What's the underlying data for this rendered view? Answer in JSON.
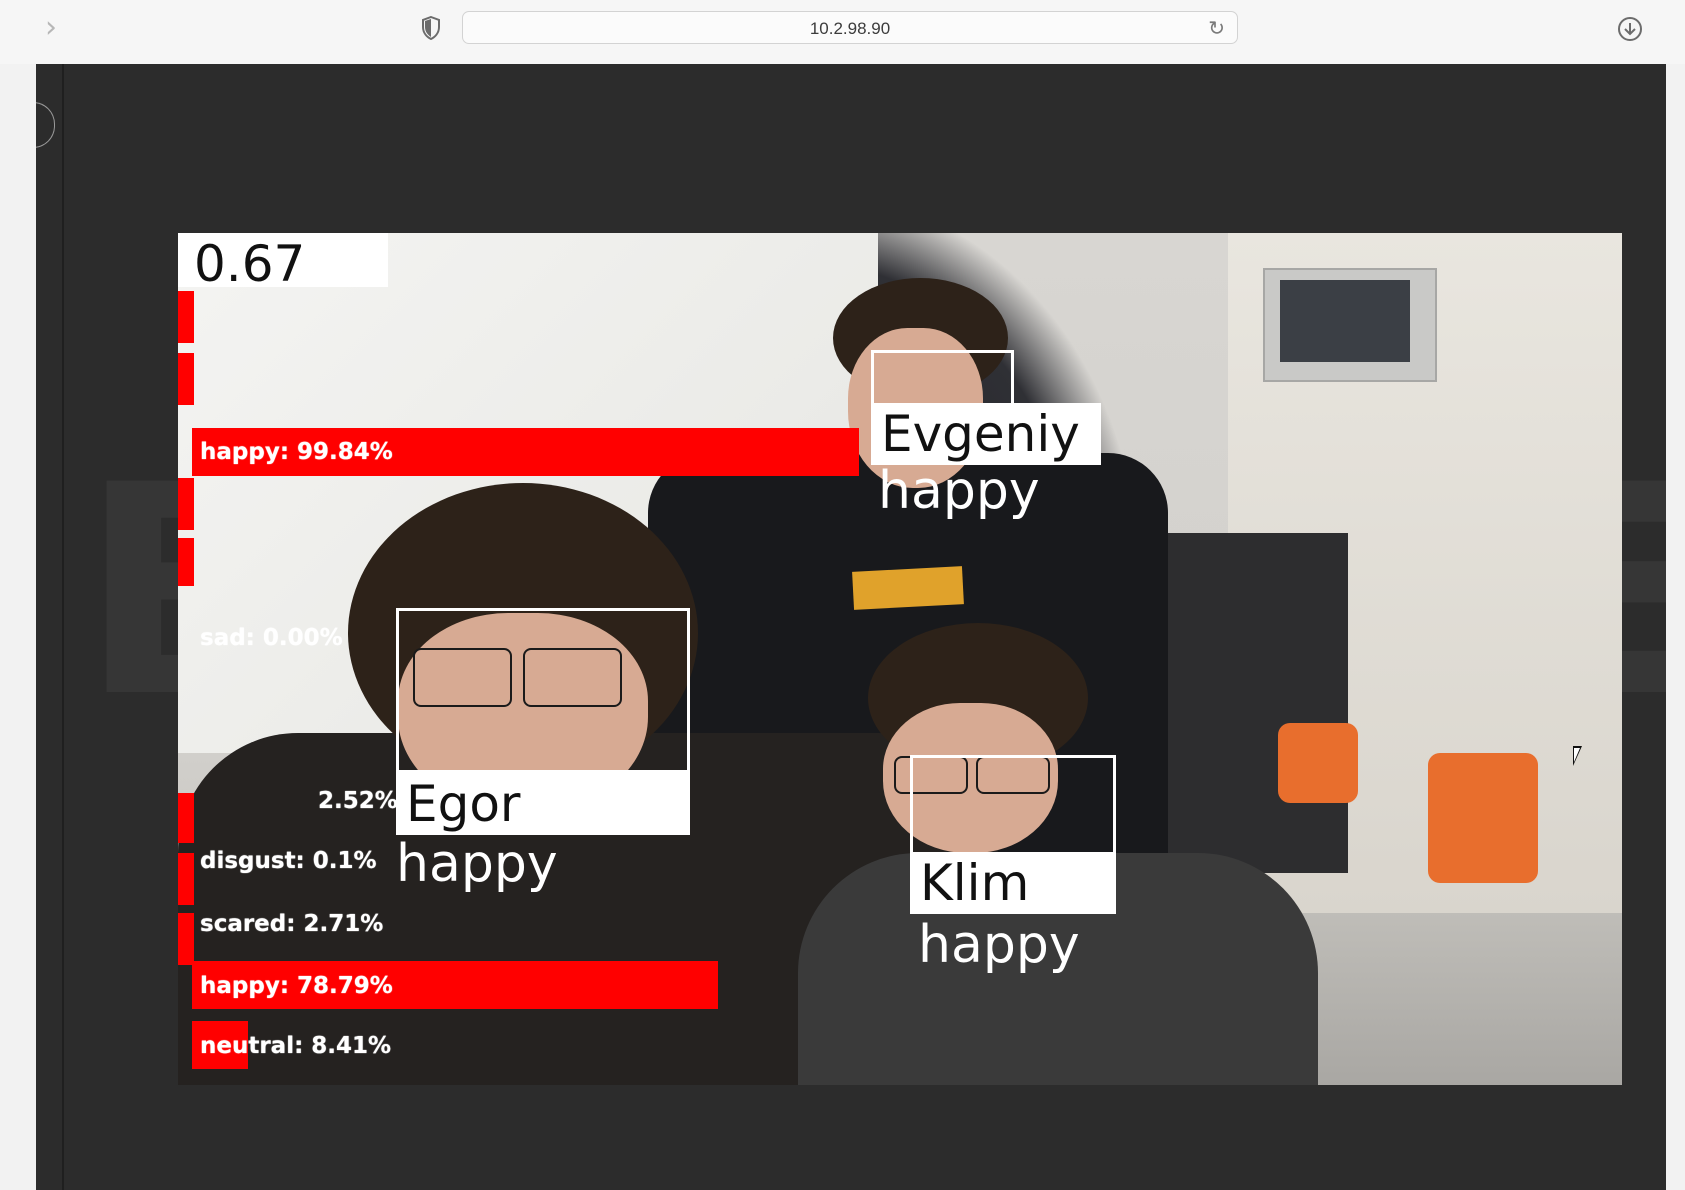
{
  "browser": {
    "address": "10.2.98.90",
    "forward_icon": "chevron-right-icon",
    "shield_icon": "shield-icon",
    "reload_icon": "reload-icon",
    "download_icon": "download-icon"
  },
  "stream": {
    "fps": "0.67",
    "bars": [
      {
        "label": "happy: 99.84%",
        "fraction": 0.9984
      },
      {
        "label": "sad: 0.00%",
        "fraction": 0.0
      },
      {
        "label": "2.52%",
        "fraction": 0.0252
      },
      {
        "label": "disgust: 0.1%",
        "fraction": 0.001
      },
      {
        "label": "scared: 2.71%",
        "fraction": 0.0271
      },
      {
        "label": "happy: 78.79%",
        "fraction": 0.7879
      },
      {
        "label": "neutral: 8.41%",
        "fraction": 0.0841
      }
    ],
    "faces": [
      {
        "name": "Evgeniy",
        "emotion": "happy"
      },
      {
        "name": "Egor",
        "emotion": "happy"
      },
      {
        "name": "Klim",
        "emotion": "happy"
      }
    ]
  },
  "colors": {
    "bar": "#ff0000",
    "page_background": "#2c2c2c",
    "toolbar": "#f6f6f6"
  }
}
